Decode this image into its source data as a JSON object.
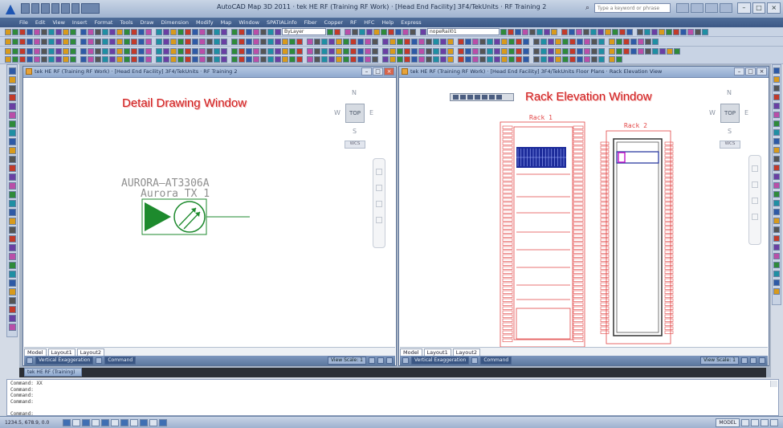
{
  "app": {
    "title": "AutoCAD Map 3D 2011 · tek HE RF (Training RF Work) · [Head End Facility] 3F4/TekUnits · RF Training 2",
    "search_placeholder": "Type a keyword or phrase",
    "menu": [
      "File",
      "Edit",
      "View",
      "Insert",
      "Format",
      "Tools",
      "Draw",
      "Dimension",
      "Modify",
      "Map",
      "Window",
      "SPATIALinfo",
      "Fiber",
      "Copper",
      "RF",
      "HFC",
      "Help",
      "Express"
    ],
    "layer_combo": "ByLayer",
    "style_combo": "nopeRail01"
  },
  "windows": {
    "detail": {
      "title": "tek HE RF (Training RF Work) · [Head End Facility] 3F4/TekUnits · RF Training 2",
      "overlay_label": "Detail Drawing Window",
      "device_model": "AURORA–AT3306A",
      "device_name": "Aurora TX 1",
      "viewcube": {
        "top": "TOP",
        "n": "N",
        "s": "S",
        "e": "E",
        "w": "W",
        "wcs": "WCS"
      },
      "layout_tabs": [
        "Model",
        "Layout1",
        "Layout2"
      ],
      "status": {
        "vert_exag": "Vertical Exaggeration",
        "command": "Command",
        "view_scale": "View Scale: 1"
      }
    },
    "rack": {
      "title": "tek HE RF (Training RF Work) · [Head End Facility] 3F4/TekUnits Floor Plans · Rack Elevation View",
      "overlay_label": "Rack Elevation Window",
      "rack1_label": "Rack 1",
      "rack2_label": "Rack 2",
      "viewcube": {
        "top": "TOP",
        "n": "N",
        "s": "S",
        "e": "E",
        "w": "W",
        "wcs": "WCS"
      },
      "layout_tabs": [
        "Model",
        "Layout1",
        "Layout2"
      ],
      "status": {
        "vert_exag": "Vertical Exaggeration",
        "command": "Command",
        "view_scale": "View Scale: 1"
      }
    },
    "minimized": {
      "title": "tek HE RF (Training)"
    }
  },
  "command_line": {
    "lines": [
      "Command: XX",
      "Command:",
      "Command:",
      "Command:",
      "",
      "Command:"
    ]
  },
  "statusbar": {
    "coords": "1234.5, 678.9, 0.0",
    "model": "MODEL"
  },
  "colors": {
    "accent": "#3c5886",
    "overlay_label": "#d01f1f",
    "device_green": "#1d8a2d",
    "rack_red": "#e24444",
    "rack2_magenta": "#c012c8",
    "equipment_blue": "#1c2b9a"
  },
  "icons": [
    "autocad-logo-icon",
    "search-icon",
    "minimize-icon",
    "maximize-icon",
    "close-icon",
    "transmitter-icon"
  ]
}
